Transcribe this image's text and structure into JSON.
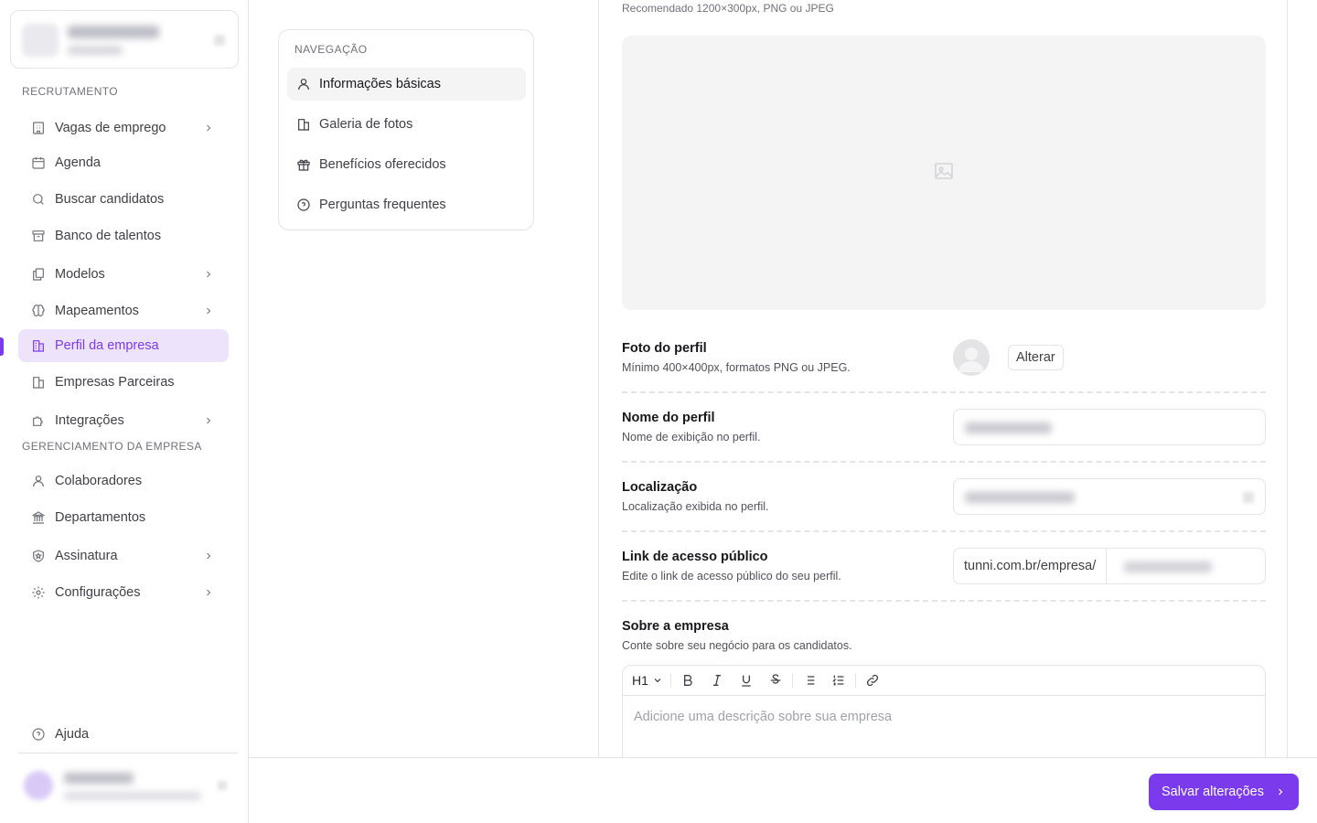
{
  "sidebar": {
    "sections": {
      "recruiting": "Recrutamento",
      "management": "Gerenciamento da empresa"
    },
    "items": [
      {
        "label": "Vagas de emprego",
        "icon": "building-icon"
      },
      {
        "label": "Agenda",
        "icon": "calendar-icon"
      },
      {
        "label": "Buscar candidatos",
        "icon": "search-icon"
      },
      {
        "label": "Banco de talentos",
        "icon": "archive-icon"
      },
      {
        "label": "Modelos",
        "icon": "copy-icon"
      },
      {
        "label": "Mapeamentos",
        "icon": "brain-icon"
      },
      {
        "label": "Perfil da empresa",
        "icon": "company-icon"
      },
      {
        "label": "Empresas Parceiras",
        "icon": "company-icon"
      },
      {
        "label": "Integrações",
        "icon": "puzzle-icon"
      },
      {
        "label": "Colaboradores",
        "icon": "user-icon"
      },
      {
        "label": "Departamentos",
        "icon": "landmark-icon"
      },
      {
        "label": "Assinatura",
        "icon": "shield-star-icon"
      },
      {
        "label": "Configurações",
        "icon": "gear-icon"
      }
    ],
    "help": "Ajuda",
    "accent": "#7c3aed"
  },
  "section_nav": {
    "title": "Navegação",
    "items": [
      {
        "label": "Informações básicas",
        "icon": "user-icon"
      },
      {
        "label": "Galeria de fotos",
        "icon": "company-icon"
      },
      {
        "label": "Benefícios oferecidos",
        "icon": "gift-icon"
      },
      {
        "label": "Perguntas frequentes",
        "icon": "help-circle-icon"
      }
    ]
  },
  "form": {
    "cover_hint": "Recomendado 1200×300px, PNG ou JPEG",
    "photo": {
      "title": "Foto do perfil",
      "desc": "Mínimo 400×400px, formatos PNG ou JPEG.",
      "button": "Alterar"
    },
    "name": {
      "title": "Nome do perfil",
      "desc": "Nome de exibição no perfil."
    },
    "location": {
      "title": "Localização",
      "desc": "Localização exibida no perfil."
    },
    "link": {
      "title": "Link de acesso público",
      "desc": "Edite o link de acesso público do seu perfil.",
      "prefix": "tunni.com.br/empresa/"
    },
    "about": {
      "title": "Sobre a empresa",
      "desc": "Conte sobre seu negócio para os candidatos.",
      "heading_level": "H1",
      "placeholder": "Adicione uma descrição sobre sua empresa"
    }
  },
  "footer": {
    "save": "Salvar alterações"
  }
}
